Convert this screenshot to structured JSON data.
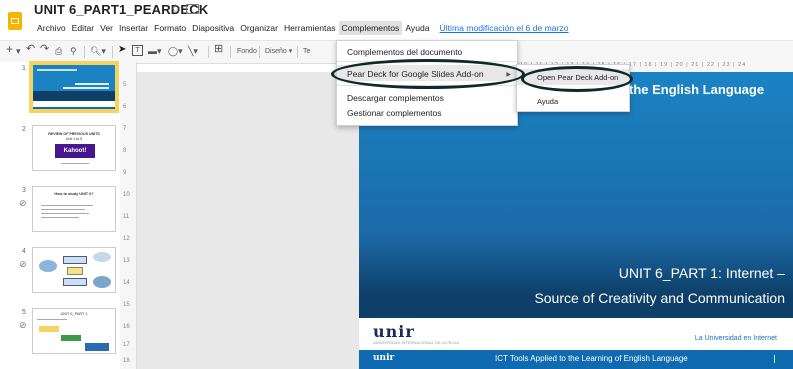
{
  "doc": {
    "title": "UNIT 6_PART1_PEARDECK"
  },
  "menubar": {
    "items": [
      "Archivo",
      "Editar",
      "Ver",
      "Insertar",
      "Formato",
      "Diapositiva",
      "Organizar",
      "Herramientas",
      "Complementos",
      "Ayuda"
    ],
    "last_modified": "Última modificación el 6 de marzo"
  },
  "toolbar": {
    "zoom_icon": "zoom-icon",
    "fondo": "Fondo",
    "diseno": "Diseño ▾",
    "tema": "Te"
  },
  "complementos_menu": {
    "items": [
      "Complementos del documento",
      "Pear Deck for Google Slides Add-on",
      "Descargar complementos",
      "Gestionar complementos"
    ]
  },
  "peardeck_submenu": {
    "items": [
      "Open Pear Deck Add-on",
      "Ayuda"
    ]
  },
  "filmstrip": {
    "numbers": [
      "1",
      "2",
      "3",
      "4",
      "5"
    ],
    "thumb2": {
      "title": "REVIEW OF PREVIOUS UNITS",
      "subtitle": "Unit 1 to 5",
      "badge": "Kahoot!"
    },
    "thumb3": {
      "title": "How to study UNIT 6?"
    },
    "thumb5": {
      "title": "UNIT 6_PART 1"
    }
  },
  "ruler_v": [
    "5",
    "6",
    "7",
    "8",
    "9",
    "10",
    "11",
    "12",
    "13",
    "14",
    "15",
    "16",
    "17",
    "18"
  ],
  "ruler_h": "10 | 11 | 12 | 13 | 14 | 15 | 16 | 17 | 18 | 19 | 20 | 21 | 22 | 23 | 24",
  "slide": {
    "title": "the English Language",
    "subtitle_line1": "UNIT 6_PART 1: Internet –",
    "subtitle_line2": "Source of Creativity and Communication",
    "logo": "unir",
    "logo_small": "UNIVERSIDAD INTERNACIONAL DE LA RIOJA",
    "tagline": "La Universidad en Internet",
    "footer_logo": "unir",
    "footer_text": "ICT Tools Applied to the Learning of English Language"
  },
  "colors": {
    "accent": "#1a73e8",
    "slide_blue": "#1b83c4",
    "ellipse": "#0c2a26",
    "selected": "#f4d35e"
  }
}
